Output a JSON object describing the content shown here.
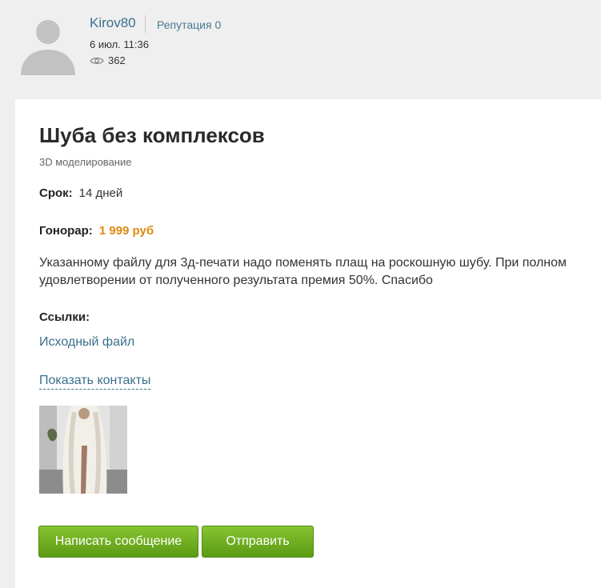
{
  "author": {
    "name": "Kirov80",
    "reputation": "Репутация 0",
    "date": "6 июл. 11:36",
    "views": "362"
  },
  "icons": {
    "avatar": "default-user-avatar",
    "views": "eye-icon"
  },
  "task": {
    "title": "Шуба без комплексов",
    "category": "3D моделирование",
    "term_label": "Срок:",
    "term_value": "14 дней",
    "fee_label": "Гонорар:",
    "fee_value": "1 999 руб",
    "description": "Указанному файлу для 3д-печати надо поменять плащ на роскошную шубу. При полном удовлетворении от полученного результата премия 50%. Спасибо",
    "links_label": "Ссылки:",
    "source_link": "Исходный файл",
    "show_contacts": "Показать контакты"
  },
  "actions": {
    "write_message": "Написать сообщение",
    "send": "Отправить"
  },
  "colors": {
    "link": "#3a6f8c",
    "fee": "#e08a10",
    "button": "#6fae1f",
    "page_bg": "#efefef",
    "card_bg": "#ffffff"
  }
}
